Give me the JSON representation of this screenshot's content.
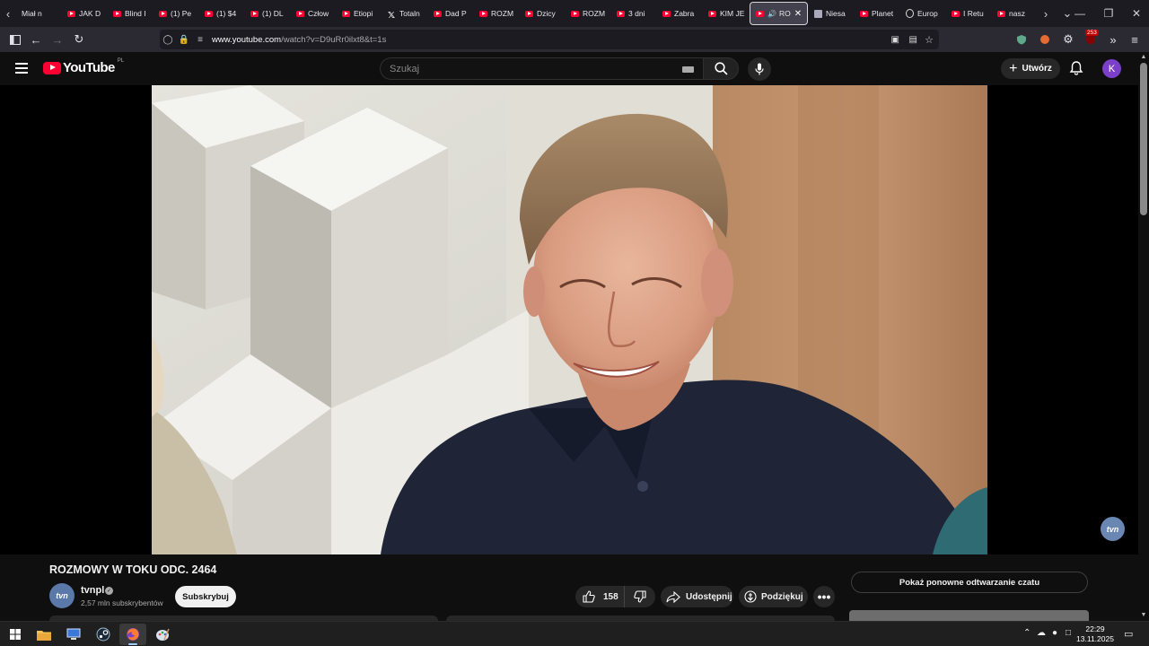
{
  "browser": {
    "tabs": [
      {
        "label": "Miał n",
        "icon": "none"
      },
      {
        "label": "JAK D",
        "icon": "youtube-icon"
      },
      {
        "label": "Blind I",
        "icon": "youtube-icon"
      },
      {
        "label": "(1) Pe",
        "icon": "youtube-icon"
      },
      {
        "label": "(1) $4",
        "icon": "youtube-icon"
      },
      {
        "label": "(1) DL",
        "icon": "youtube-icon"
      },
      {
        "label": "Człow",
        "icon": "youtube-icon"
      },
      {
        "label": "Etiopi",
        "icon": "youtube-icon"
      },
      {
        "label": "Totaln",
        "icon": "x-icon"
      },
      {
        "label": "Dad P",
        "icon": "youtube-icon"
      },
      {
        "label": "ROZM",
        "icon": "youtube-icon"
      },
      {
        "label": "Dzicy",
        "icon": "youtube-icon"
      },
      {
        "label": "ROZM",
        "icon": "youtube-icon"
      },
      {
        "label": "3 dni",
        "icon": "youtube-icon"
      },
      {
        "label": "Zabra",
        "icon": "youtube-icon"
      },
      {
        "label": "KIM JE",
        "icon": "youtube-icon"
      },
      {
        "label": "RO",
        "icon": "youtube-icon",
        "active": true,
        "playing": true
      },
      {
        "label": "Niesa",
        "icon": "document-icon"
      },
      {
        "label": "Planet",
        "icon": "youtube-icon"
      },
      {
        "label": "Europ",
        "icon": "globe-icon"
      },
      {
        "label": "I Retu",
        "icon": "youtube-icon"
      },
      {
        "label": "nasz",
        "icon": "youtube-icon"
      }
    ],
    "url_host": "www.youtube.com",
    "url_path": "/watch?v=D9uRr0ilxt8&t=1s",
    "extension_badge": "253"
  },
  "youtube": {
    "logo_text": "YouTube",
    "country_code": "PL",
    "search_placeholder": "Szukaj",
    "create_label": "Utwórz",
    "avatar_letter": "K"
  },
  "video": {
    "title": "ROZMOWY W TOKU ODC. 2464",
    "channel_name": "tvnpl",
    "channel_logo_text": "tvn",
    "subscribers": "2,57 mln subskrybentów",
    "subscribe_label": "Subskrybuj",
    "likes": "158",
    "share_label": "Udostępnij",
    "thanks_label": "Podziękuj",
    "chat_replay_label": "Pokaż ponowne odtwarzanie czatu",
    "watermark_text": "tvn"
  },
  "taskbar": {
    "time": "22:29",
    "date": "13.11.2025"
  },
  "colors": {
    "youtube_red": "#ff0033",
    "background": "#0f0f0f",
    "avatar": "#7b3fc9"
  }
}
